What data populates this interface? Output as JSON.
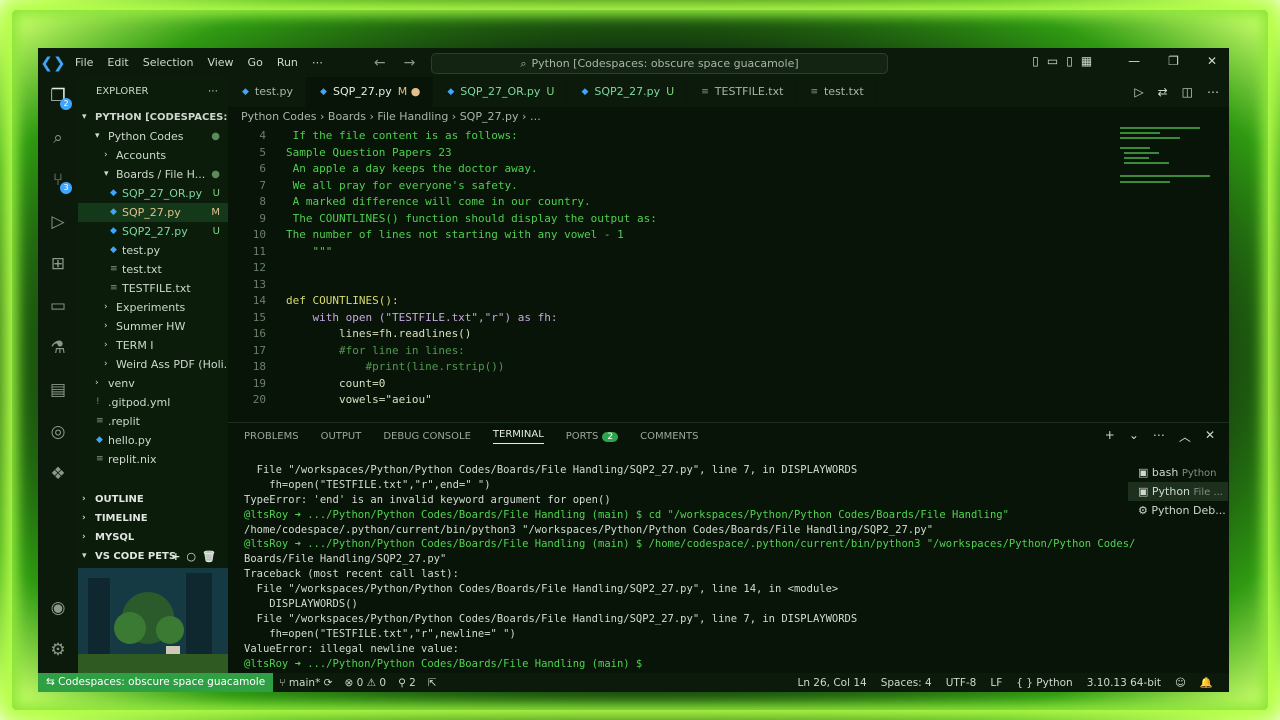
{
  "titlebar": {
    "menus": [
      "File",
      "Edit",
      "Selection",
      "View",
      "Go",
      "Run",
      "⋯"
    ],
    "search_text": "Python [Codespaces: obscure space guacamole]"
  },
  "activity": {
    "explorer_badge": "2",
    "scm_badge": "3"
  },
  "sidebar": {
    "title": "EXPLORER",
    "workspace": "PYTHON [CODESPACES: O...",
    "items": [
      {
        "label": "Python Codes",
        "status": "●"
      },
      {
        "label": "Accounts",
        "status": ""
      },
      {
        "label": "Boards / File H...",
        "status": "●"
      },
      {
        "label": "SQP_27_OR.py",
        "status": "U"
      },
      {
        "label": "SQP_27.py",
        "status": "M"
      },
      {
        "label": "SQP2_27.py",
        "status": "U"
      },
      {
        "label": "test.py",
        "status": ""
      },
      {
        "label": "test.txt",
        "status": ""
      },
      {
        "label": "TESTFILE.txt",
        "status": ""
      },
      {
        "label": "Experiments",
        "status": ""
      },
      {
        "label": "Summer HW",
        "status": ""
      },
      {
        "label": "TERM I",
        "status": ""
      },
      {
        "label": "Weird Ass PDF (Holi...",
        "status": ""
      },
      {
        "label": "venv",
        "status": ""
      },
      {
        "label": ".gitpod.yml",
        "status": ""
      },
      {
        "label": ".replit",
        "status": ""
      },
      {
        "label": "hello.py",
        "status": ""
      },
      {
        "label": "replit.nix",
        "status": ""
      }
    ],
    "sections": [
      "OUTLINE",
      "TIMELINE",
      "MYSQL",
      "VS CODE PETS"
    ]
  },
  "tabs": [
    {
      "label": "test.py",
      "mod": ""
    },
    {
      "label": "SQP_27.py",
      "mod": "M ●"
    },
    {
      "label": "SQP_27_OR.py",
      "mod": "U"
    },
    {
      "label": "SQP2_27.py",
      "mod": "U"
    },
    {
      "label": "TESTFILE.txt",
      "mod": ""
    },
    {
      "label": "test.txt",
      "mod": ""
    }
  ],
  "breadcrumb": "Python Codes  ›  Boards  ›  File Handling  ›  SQP_27.py  ›  …",
  "code": {
    "line_numbers": [
      "4",
      "5",
      "6",
      "7",
      "8",
      "9",
      "10",
      "11",
      "12",
      "13",
      "14",
      "15",
      "16",
      "17",
      "18",
      "19",
      "20"
    ],
    "lines": [
      " If the file content is as follows:",
      "Sample Question Papers 23",
      " An apple a day keeps the doctor away.",
      " We all pray for everyone's safety.",
      " A marked difference will come in our country.",
      " The COUNTLINES() function should display the output as:",
      "The number of lines not starting with any vowel - 1",
      "    \"\"\"",
      "",
      "",
      "def COUNTLINES():",
      "    with open (\"TESTFILE.txt\",\"r\") as fh:",
      "        lines=fh.readlines()",
      "        #for line in lines:",
      "            #print(line.rstrip())",
      "        count=0",
      "        vowels=\"aeiou\""
    ]
  },
  "panel": {
    "tabs": [
      "PROBLEMS",
      "OUTPUT",
      "DEBUG CONSOLE",
      "TERMINAL",
      "PORTS",
      "COMMENTS"
    ],
    "ports_badge": "2",
    "terminal_lines": [
      "  File \"/workspaces/Python/Python Codes/Boards/File Handling/SQP2_27.py\", line 7, in DISPLAYWORDS",
      "    fh=open(\"TESTFILE.txt\",\"r\",end=\" \")",
      "TypeError: 'end' is an invalid keyword argument for open()",
      "@ltsRoy ➜ .../Python/Python Codes/Boards/File Handling (main) $ cd \"/workspaces/Python/Python Codes/Boards/File Handling\"",
      "/home/codespace/.python/current/bin/python3 \"/workspaces/Python/Python Codes/Boards/File Handling/SQP2_27.py\"",
      "@ltsRoy ➜ .../Python/Python Codes/Boards/File Handling (main) $ /home/codespace/.python/current/bin/python3 \"/workspaces/Python/Python Codes/",
      "Boards/File Handling/SQP2_27.py\"",
      "Traceback (most recent call last):",
      "  File \"/workspaces/Python/Python Codes/Boards/File Handling/SQP2_27.py\", line 14, in <module>",
      "    DISPLAYWORDS()",
      "  File \"/workspaces/Python/Python Codes/Boards/File Handling/SQP2_27.py\", line 7, in DISPLAYWORDS",
      "    fh=open(\"TESTFILE.txt\",\"r\",newline=\" \")",
      "ValueError: illegal newline value:",
      "@ltsRoy ➜ .../Python/Python Codes/Boards/File Handling (main) $"
    ],
    "terminals": [
      {
        "name": "bash",
        "sub": "Python"
      },
      {
        "name": "Python",
        "sub": "File ..."
      },
      {
        "name": "Python Deb...",
        "sub": ""
      }
    ]
  },
  "statusbar": {
    "remote": "Codespaces: obscure space guacamole",
    "branch": "main*",
    "problems": "⊗ 0 ⚠ 0",
    "ports": "2",
    "position": "Ln 26, Col 14",
    "spaces": "Spaces: 4",
    "encoding": "UTF-8",
    "eol": "LF",
    "language": "Python",
    "interpreter": "3.10.13 64-bit"
  },
  "colors": {
    "accent": "#3ea6ff",
    "remote": "#2ea043",
    "code_text": "#4fcf4f",
    "glow": "#b6ff4a"
  }
}
